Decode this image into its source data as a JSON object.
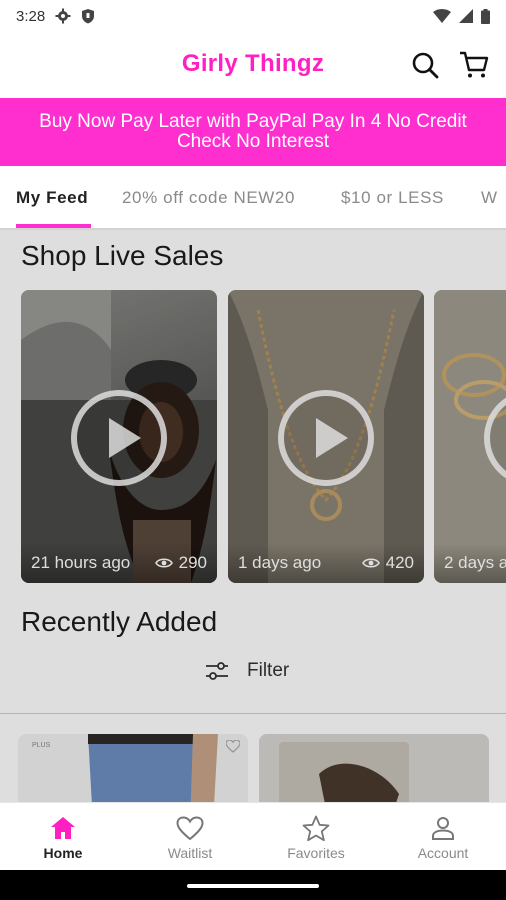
{
  "status_bar": {
    "time": "3:28"
  },
  "app": {
    "title": "Girly Thingz"
  },
  "banner": {
    "line1": "Buy Now Pay Later with PayPal Pay In 4 No Credit",
    "line2": "Check No Interest"
  },
  "tabs": [
    {
      "label": "My Feed",
      "active": true
    },
    {
      "label": "20% off code NEW20",
      "active": false
    },
    {
      "label": "$10 or LESS",
      "active": false
    },
    {
      "label": "W",
      "active": false
    }
  ],
  "live_sales": {
    "title": "Shop Live Sales",
    "cards": [
      {
        "time_ago": "21 hours ago",
        "views": "290"
      },
      {
        "time_ago": "1 days ago",
        "views": "420"
      },
      {
        "time_ago": "2 days a",
        "views": ""
      }
    ]
  },
  "recently_added": {
    "title": "Recently Added",
    "filter_label": "Filter",
    "plus_badge": "PLUS"
  },
  "bottom_nav": [
    {
      "label": "Home",
      "icon": "home-icon",
      "active": true
    },
    {
      "label": "Waitlist",
      "icon": "heart-icon",
      "active": false
    },
    {
      "label": "Favorites",
      "icon": "star-icon",
      "active": false
    },
    {
      "label": "Account",
      "icon": "person-icon",
      "active": false
    }
  ],
  "colors": {
    "brand_pink": "#ff1fc2",
    "banner_pink": "#ff2fcf"
  }
}
